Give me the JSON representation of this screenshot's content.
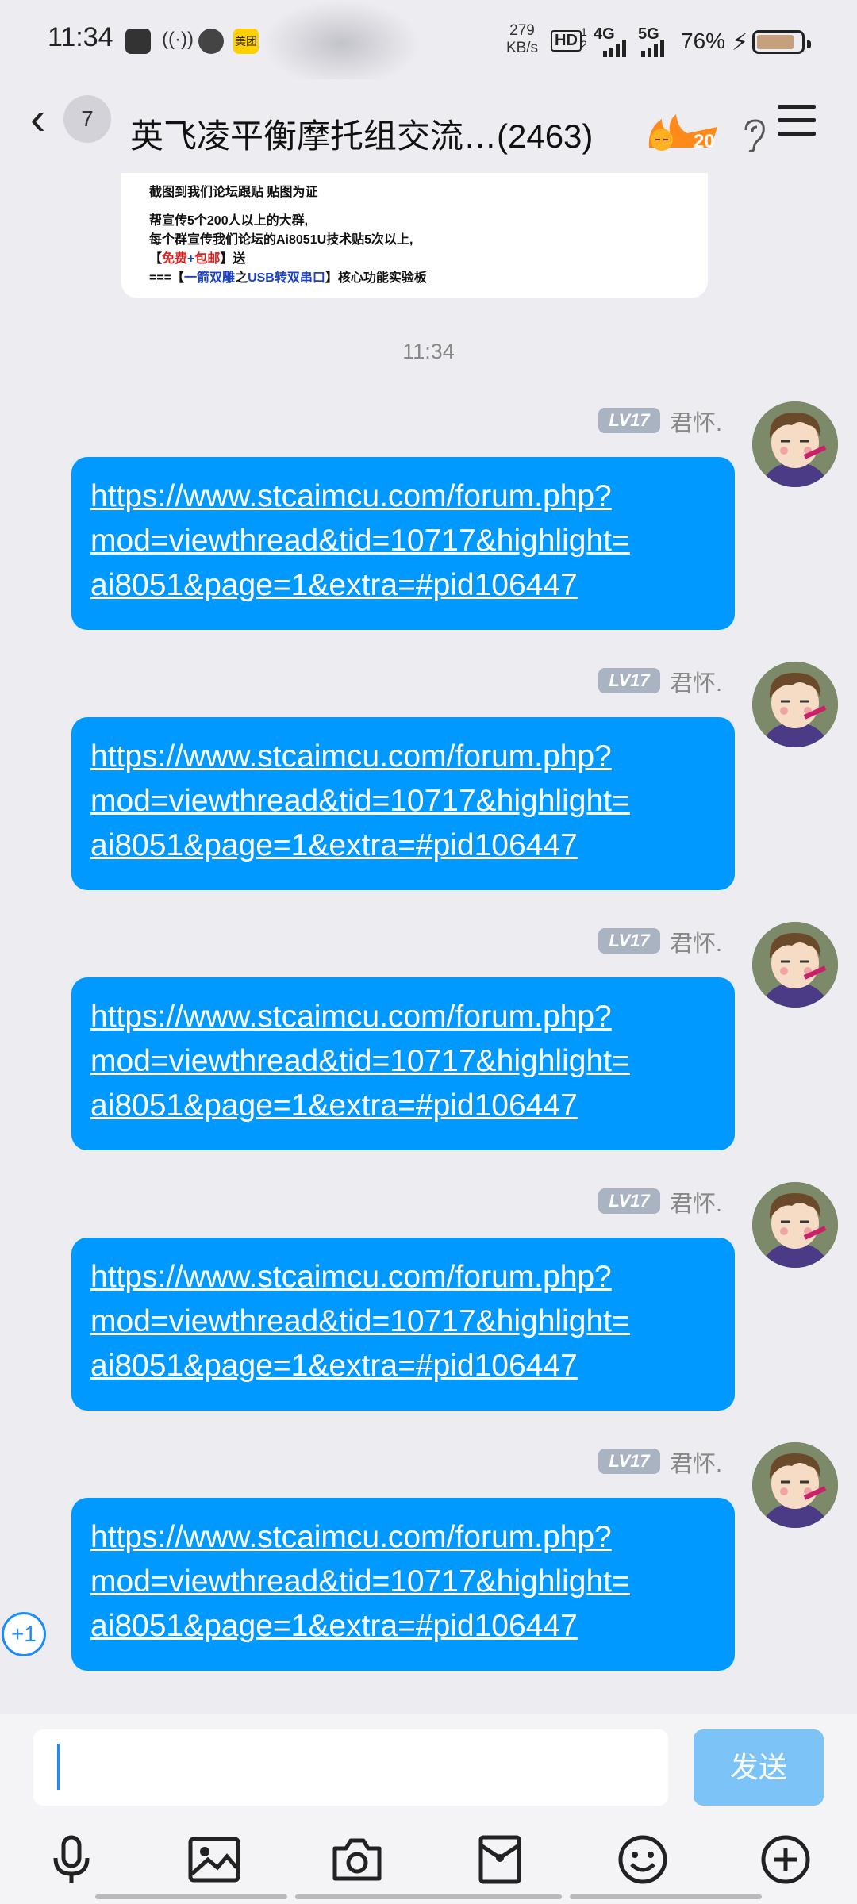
{
  "status_bar": {
    "time": "11:34",
    "net_speed_value": "279",
    "net_speed_unit": "KB/s",
    "hd": "HD",
    "hd_sub": "1 2",
    "net1": "4G",
    "net2": "5G",
    "battery_pct": "76%",
    "app_icon_label": "美团"
  },
  "header": {
    "back_badge": "7",
    "title": "英飞凌平衡摩托组交流…(2463)",
    "fire_level": "20"
  },
  "card": {
    "line1": "截图到我们论坛跟贴 贴图为证",
    "line2": "帮宣传5个200人以上的大群,",
    "line3": "每个群宣传我们论坛的Ai8051U技术贴5次以上,",
    "line4_pre": "【",
    "line4_red": "免费",
    "line4_mid": "+",
    "line4_red2": "包邮",
    "line4_post": "】送",
    "line5_pre": "===【",
    "line5_blue": "一箭双雕",
    "line5_mid": "之",
    "line5_blue2": "USB转双串口",
    "line5_post": "】核心功能实验板"
  },
  "timestamp": "11:34",
  "messages": [
    {
      "level": "LV17",
      "sender": "君怀.",
      "lines": [
        "https://www.stcaimcu.com/forum.php?",
        "mod=viewthread&tid=10717&highlight=",
        "ai8051&page=1&extra=#pid106447"
      ]
    },
    {
      "level": "LV17",
      "sender": "君怀.",
      "lines": [
        "https://www.stcaimcu.com/forum.php?",
        "mod=viewthread&tid=10717&highlight=",
        "ai8051&page=1&extra=#pid106447"
      ]
    },
    {
      "level": "LV17",
      "sender": "君怀.",
      "lines": [
        "https://www.stcaimcu.com/forum.php?",
        "mod=viewthread&tid=10717&highlight=",
        "ai8051&page=1&extra=#pid106447"
      ]
    },
    {
      "level": "LV17",
      "sender": "君怀.",
      "lines": [
        "https://www.stcaimcu.com/forum.php?",
        "mod=viewthread&tid=10717&highlight=",
        "ai8051&page=1&extra=#pid106447"
      ]
    },
    {
      "level": "LV17",
      "sender": "君怀.",
      "lines": [
        "https://www.stcaimcu.com/forum.php?",
        "mod=viewthread&tid=10717&highlight=",
        "ai8051&page=1&extra=#pid106447"
      ]
    }
  ],
  "plus_one": "+1",
  "input": {
    "value": "",
    "send_label": "发送"
  },
  "toolbar": [
    "microphone-icon",
    "image-icon",
    "camera-icon",
    "red-packet-icon",
    "emoji-icon",
    "plus-icon"
  ],
  "colors": {
    "bubble": "#0099ff",
    "send_button": "#7cc4f7",
    "background": "#ededf1"
  }
}
